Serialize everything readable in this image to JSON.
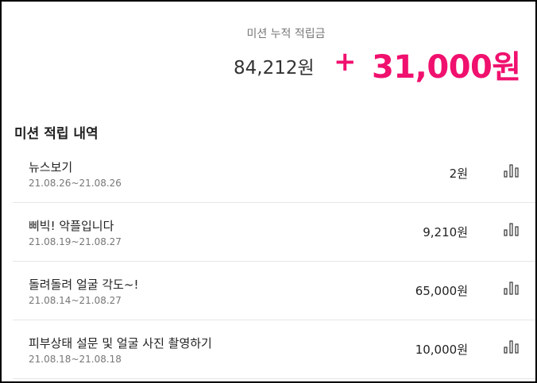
{
  "summary": {
    "label": "미션 누적 적립금",
    "total": "84,212원",
    "plus": "+",
    "bonus": "31,000원"
  },
  "section": {
    "title": "미션 적립 내역"
  },
  "missions": [
    {
      "title": "뉴스보기",
      "period": "21.08.26~21.08.26",
      "amount": "2원",
      "icon": "bar-chart-icon"
    },
    {
      "title": "삐빅! 악플입니다",
      "period": "21.08.19~21.08.27",
      "amount": "9,210원",
      "icon": "bar-chart-icon"
    },
    {
      "title": "돌려돌려 얼굴 각도~!",
      "period": "21.08.14~21.08.27",
      "amount": "65,000원",
      "icon": "bar-chart-icon"
    },
    {
      "title": "피부상태 설문 및 얼굴 사진 촬영하기",
      "period": "21.08.18~21.08.18",
      "amount": "10,000원",
      "icon": "bar-chart-icon"
    }
  ],
  "colors": {
    "accent": "#f0106e",
    "text": "#222222",
    "muted": "#777777"
  }
}
